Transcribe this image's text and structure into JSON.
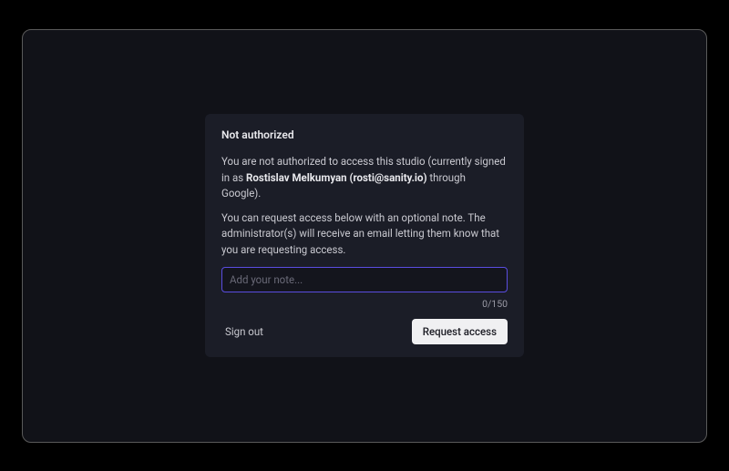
{
  "dialog": {
    "title": "Not authorized",
    "body1_prefix": "You are not authorized to access this studio (currently signed in as ",
    "user_name": "Rostislav Melkumyan (rosti@sanity.io)",
    "body1_suffix": " through Google).",
    "body2": "You can request access below with an optional note. The administrator(s) will receive an email letting them know that you are requesting access.",
    "note": {
      "placeholder": "Add your note...",
      "value": "",
      "count": "0/150"
    },
    "buttons": {
      "signout": "Sign out",
      "request": "Request access"
    }
  }
}
